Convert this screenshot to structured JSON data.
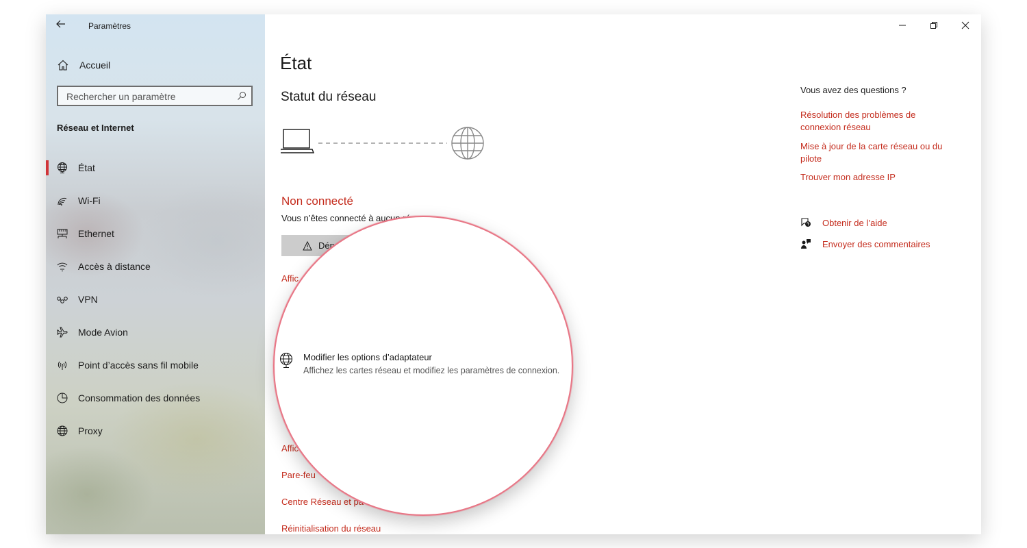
{
  "window": {
    "title": "Paramètres",
    "controls": [
      "minimize",
      "restore",
      "close"
    ]
  },
  "sidebar": {
    "home_label": "Accueil",
    "search_placeholder": "Rechercher un paramètre",
    "section_title": "Réseau et Internet",
    "items": [
      {
        "label": "État",
        "icon": "globe-status-icon",
        "active": true
      },
      {
        "label": "Wi-Fi",
        "icon": "wifi-icon"
      },
      {
        "label": "Ethernet",
        "icon": "ethernet-icon"
      },
      {
        "label": "Accès à distance",
        "icon": "dial-up-icon"
      },
      {
        "label": "VPN",
        "icon": "vpn-icon"
      },
      {
        "label": "Mode Avion",
        "icon": "airplane-icon"
      },
      {
        "label": "Point d’accès sans fil mobile",
        "icon": "hotspot-icon"
      },
      {
        "label": "Consommation des données",
        "icon": "data-usage-icon"
      },
      {
        "label": "Proxy",
        "icon": "globe-icon"
      }
    ]
  },
  "main": {
    "page_title": "État",
    "status_title": "Statut du réseau",
    "status": "Non connecté",
    "status_desc": "Vous n’êtes connecté à aucun réseau.",
    "troubleshoot_label": "Dépanner",
    "links_visible": [
      "Affic",
      "Affic",
      "Pare-feu",
      "Centre Réseau et pa",
      "Réinitialisation du réseau"
    ]
  },
  "magnifier": {
    "adapter_title": "Modifier les options d’adaptateur",
    "adapter_desc": "Affichez les cartes réseau et modifiez les paramètres de connexion."
  },
  "help": {
    "question": "Vous avez des questions ?",
    "links": [
      "Résolution des problèmes de connexion réseau",
      "Mise à jour de la carte réseau ou du pilote",
      "Trouver mon adresse IP"
    ],
    "get_help": "Obtenir de l’aide",
    "feedback": "Envoyer des commentaires"
  },
  "colors": {
    "accent": "#c42b1c",
    "magnifier_border": "#e87585"
  }
}
